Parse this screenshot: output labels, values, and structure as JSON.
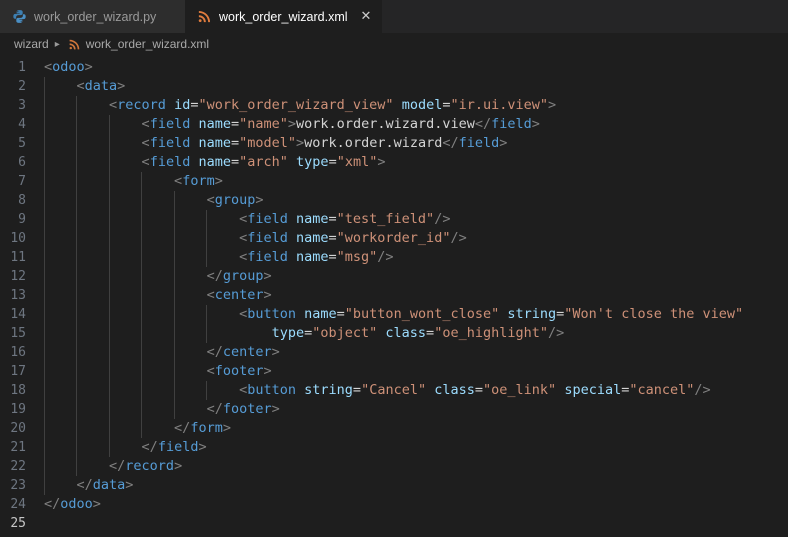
{
  "tabs": [
    {
      "label": "work_order_wizard.py",
      "icon": "python-file-icon",
      "active": false,
      "closable": false
    },
    {
      "label": "work_order_wizard.xml",
      "icon": "xml-file-icon",
      "active": true,
      "closable": true,
      "close_glyph": "✕"
    }
  ],
  "breadcrumb": {
    "folder": "wizard",
    "separator": "▸",
    "file": "work_order_wizard.xml",
    "file_icon": "xml-file-icon"
  },
  "editor": {
    "language": "xml",
    "current_line": 25,
    "total_lines": 25,
    "colors": {
      "background": "#1e1e1e",
      "tag": "#569cd6",
      "attribute": "#9cdcfe",
      "value": "#ce9178",
      "punctuation": "#808080",
      "text": "#d4d4d4",
      "line_number": "#6e7681",
      "line_number_active": "#c6c6c6",
      "indent_guide": "#404040",
      "tab_inactive_bg": "#2d2d2d",
      "tab_active_bg": "#1e1e1e",
      "tabbar_bg": "#252526"
    },
    "lines": [
      {
        "n": 1,
        "indent": 0,
        "guides": 0,
        "tokens": [
          [
            "punc",
            "<"
          ],
          [
            "tag",
            "odoo"
          ],
          [
            "punc",
            ">"
          ]
        ]
      },
      {
        "n": 2,
        "indent": 1,
        "guides": 1,
        "tokens": [
          [
            "punc",
            "<"
          ],
          [
            "tag",
            "data"
          ],
          [
            "punc",
            ">"
          ]
        ]
      },
      {
        "n": 3,
        "indent": 2,
        "guides": 2,
        "tokens": [
          [
            "punc",
            "<"
          ],
          [
            "tag",
            "record"
          ],
          [
            "text",
            " "
          ],
          [
            "attr",
            "id"
          ],
          [
            "eq",
            "="
          ],
          [
            "val",
            "\"work_order_wizard_view\""
          ],
          [
            "text",
            " "
          ],
          [
            "attr",
            "model"
          ],
          [
            "eq",
            "="
          ],
          [
            "val",
            "\"ir.ui.view\""
          ],
          [
            "punc",
            ">"
          ]
        ]
      },
      {
        "n": 4,
        "indent": 3,
        "guides": 3,
        "tokens": [
          [
            "punc",
            "<"
          ],
          [
            "tag",
            "field"
          ],
          [
            "text",
            " "
          ],
          [
            "attr",
            "name"
          ],
          [
            "eq",
            "="
          ],
          [
            "val",
            "\"name\""
          ],
          [
            "punc",
            ">"
          ],
          [
            "text",
            "work.order.wizard.view"
          ],
          [
            "punc",
            "</"
          ],
          [
            "tag",
            "field"
          ],
          [
            "punc",
            ">"
          ]
        ]
      },
      {
        "n": 5,
        "indent": 3,
        "guides": 3,
        "tokens": [
          [
            "punc",
            "<"
          ],
          [
            "tag",
            "field"
          ],
          [
            "text",
            " "
          ],
          [
            "attr",
            "name"
          ],
          [
            "eq",
            "="
          ],
          [
            "val",
            "\"model\""
          ],
          [
            "punc",
            ">"
          ],
          [
            "text",
            "work.order.wizard"
          ],
          [
            "punc",
            "</"
          ],
          [
            "tag",
            "field"
          ],
          [
            "punc",
            ">"
          ]
        ]
      },
      {
        "n": 6,
        "indent": 3,
        "guides": 3,
        "tokens": [
          [
            "punc",
            "<"
          ],
          [
            "tag",
            "field"
          ],
          [
            "text",
            " "
          ],
          [
            "attr",
            "name"
          ],
          [
            "eq",
            "="
          ],
          [
            "val",
            "\"arch\""
          ],
          [
            "text",
            " "
          ],
          [
            "attr",
            "type"
          ],
          [
            "eq",
            "="
          ],
          [
            "val",
            "\"xml\""
          ],
          [
            "punc",
            ">"
          ]
        ]
      },
      {
        "n": 7,
        "indent": 4,
        "guides": 4,
        "tokens": [
          [
            "punc",
            "<"
          ],
          [
            "tag",
            "form"
          ],
          [
            "punc",
            ">"
          ]
        ]
      },
      {
        "n": 8,
        "indent": 5,
        "guides": 5,
        "tokens": [
          [
            "punc",
            "<"
          ],
          [
            "tag",
            "group"
          ],
          [
            "punc",
            ">"
          ]
        ]
      },
      {
        "n": 9,
        "indent": 6,
        "guides": 6,
        "tokens": [
          [
            "punc",
            "<"
          ],
          [
            "tag",
            "field"
          ],
          [
            "text",
            " "
          ],
          [
            "attr",
            "name"
          ],
          [
            "eq",
            "="
          ],
          [
            "val",
            "\"test_field\""
          ],
          [
            "punc",
            "/>"
          ]
        ]
      },
      {
        "n": 10,
        "indent": 6,
        "guides": 6,
        "tokens": [
          [
            "punc",
            "<"
          ],
          [
            "tag",
            "field"
          ],
          [
            "text",
            " "
          ],
          [
            "attr",
            "name"
          ],
          [
            "eq",
            "="
          ],
          [
            "val",
            "\"workorder_id\""
          ],
          [
            "punc",
            "/>"
          ]
        ]
      },
      {
        "n": 11,
        "indent": 6,
        "guides": 6,
        "tokens": [
          [
            "punc",
            "<"
          ],
          [
            "tag",
            "field"
          ],
          [
            "text",
            " "
          ],
          [
            "attr",
            "name"
          ],
          [
            "eq",
            "="
          ],
          [
            "val",
            "\"msg\""
          ],
          [
            "punc",
            "/>"
          ]
        ]
      },
      {
        "n": 12,
        "indent": 5,
        "guides": 5,
        "tokens": [
          [
            "punc",
            "</"
          ],
          [
            "tag",
            "group"
          ],
          [
            "punc",
            ">"
          ]
        ]
      },
      {
        "n": 13,
        "indent": 5,
        "guides": 5,
        "tokens": [
          [
            "punc",
            "<"
          ],
          [
            "tag",
            "center"
          ],
          [
            "punc",
            ">"
          ]
        ]
      },
      {
        "n": 14,
        "indent": 6,
        "guides": 6,
        "tokens": [
          [
            "punc",
            "<"
          ],
          [
            "tag",
            "button"
          ],
          [
            "text",
            " "
          ],
          [
            "attr",
            "name"
          ],
          [
            "eq",
            "="
          ],
          [
            "val",
            "\"button_wont_close\""
          ],
          [
            "text",
            " "
          ],
          [
            "attr",
            "string"
          ],
          [
            "eq",
            "="
          ],
          [
            "val",
            "\"Won't close the view\""
          ]
        ]
      },
      {
        "n": 15,
        "indent": 7,
        "guides": 6,
        "tokens": [
          [
            "attr",
            "type"
          ],
          [
            "eq",
            "="
          ],
          [
            "val",
            "\"object\""
          ],
          [
            "text",
            " "
          ],
          [
            "attr",
            "class"
          ],
          [
            "eq",
            "="
          ],
          [
            "val",
            "\"oe_highlight\""
          ],
          [
            "punc",
            "/>"
          ]
        ]
      },
      {
        "n": 16,
        "indent": 5,
        "guides": 5,
        "tokens": [
          [
            "punc",
            "</"
          ],
          [
            "tag",
            "center"
          ],
          [
            "punc",
            ">"
          ]
        ]
      },
      {
        "n": 17,
        "indent": 5,
        "guides": 5,
        "tokens": [
          [
            "punc",
            "<"
          ],
          [
            "tag",
            "footer"
          ],
          [
            "punc",
            ">"
          ]
        ]
      },
      {
        "n": 18,
        "indent": 6,
        "guides": 6,
        "tokens": [
          [
            "punc",
            "<"
          ],
          [
            "tag",
            "button"
          ],
          [
            "text",
            " "
          ],
          [
            "attr",
            "string"
          ],
          [
            "eq",
            "="
          ],
          [
            "val",
            "\"Cancel\""
          ],
          [
            "text",
            " "
          ],
          [
            "attr",
            "class"
          ],
          [
            "eq",
            "="
          ],
          [
            "val",
            "\"oe_link\""
          ],
          [
            "text",
            " "
          ],
          [
            "attr",
            "special"
          ],
          [
            "eq",
            "="
          ],
          [
            "val",
            "\"cancel\""
          ],
          [
            "punc",
            "/>"
          ]
        ]
      },
      {
        "n": 19,
        "indent": 5,
        "guides": 5,
        "tokens": [
          [
            "punc",
            "</"
          ],
          [
            "tag",
            "footer"
          ],
          [
            "punc",
            ">"
          ]
        ]
      },
      {
        "n": 20,
        "indent": 4,
        "guides": 4,
        "tokens": [
          [
            "punc",
            "</"
          ],
          [
            "tag",
            "form"
          ],
          [
            "punc",
            ">"
          ]
        ]
      },
      {
        "n": 21,
        "indent": 3,
        "guides": 3,
        "tokens": [
          [
            "punc",
            "</"
          ],
          [
            "tag",
            "field"
          ],
          [
            "punc",
            ">"
          ]
        ]
      },
      {
        "n": 22,
        "indent": 2,
        "guides": 2,
        "tokens": [
          [
            "punc",
            "</"
          ],
          [
            "tag",
            "record"
          ],
          [
            "punc",
            ">"
          ]
        ]
      },
      {
        "n": 23,
        "indent": 1,
        "guides": 1,
        "tokens": [
          [
            "punc",
            "</"
          ],
          [
            "tag",
            "data"
          ],
          [
            "punc",
            ">"
          ]
        ]
      },
      {
        "n": 24,
        "indent": 0,
        "guides": 0,
        "tokens": [
          [
            "punc",
            "</"
          ],
          [
            "tag",
            "odoo"
          ],
          [
            "punc",
            ">"
          ]
        ]
      },
      {
        "n": 25,
        "indent": 0,
        "guides": 0,
        "tokens": []
      }
    ]
  }
}
